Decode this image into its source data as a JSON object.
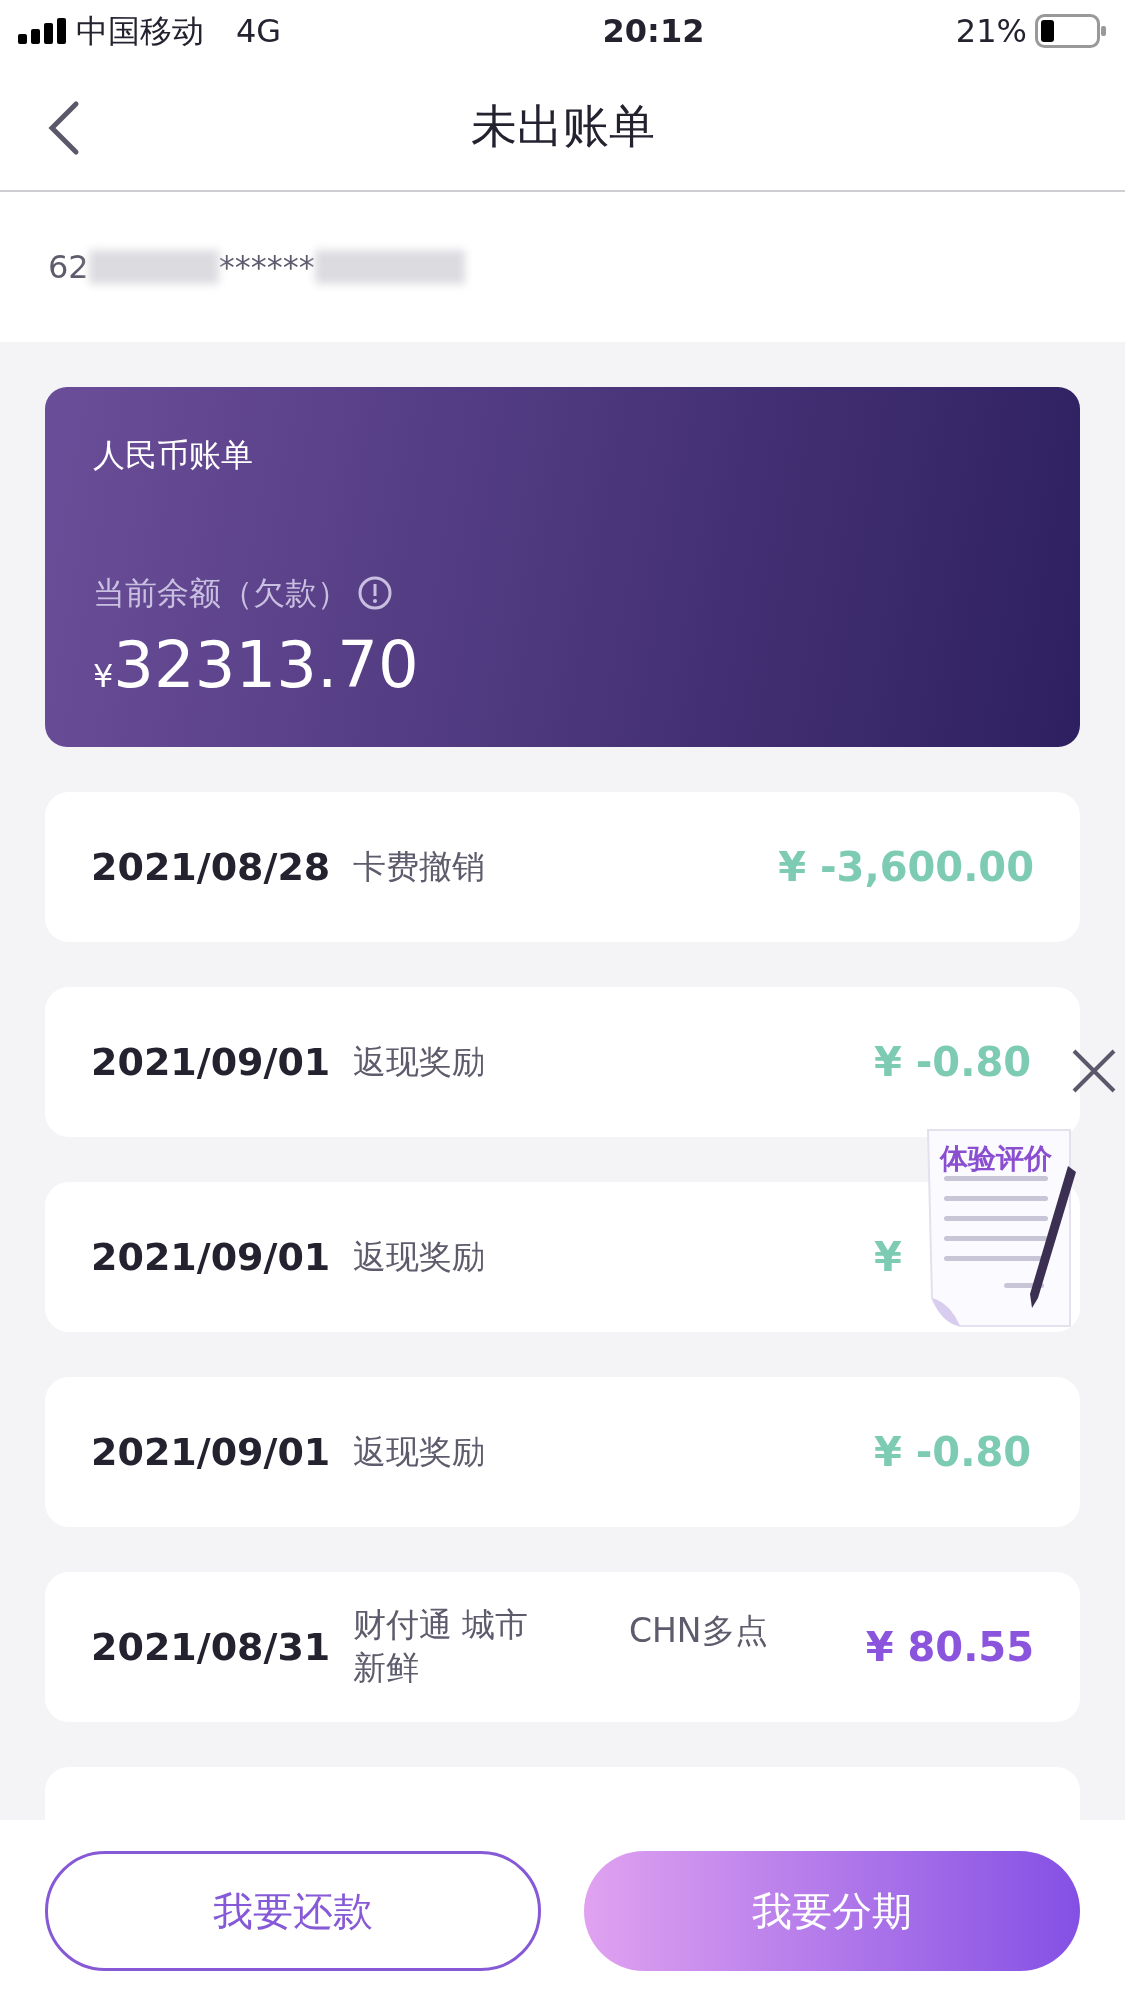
{
  "status_bar": {
    "carrier": "中国移动",
    "network": "4G",
    "time": "20:12",
    "battery": "21%"
  },
  "nav": {
    "title": "未出账单"
  },
  "card_number": {
    "prefix": "62",
    "masked": "******"
  },
  "balance_card": {
    "title": "人民币账单",
    "label": "当前余额（欠款）",
    "currency": "¥",
    "amount": "32313.70"
  },
  "transactions": [
    {
      "date": "2021/08/28",
      "description": "卡费撤销",
      "amount": "¥ -3,600.00",
      "kind": "credit"
    },
    {
      "date": "2021/09/01",
      "description": "返现奖励",
      "amount": "¥ -0.80",
      "kind": "credit"
    },
    {
      "date": "2021/09/01",
      "description": "返现奖励",
      "amount": "¥",
      "kind": "credit"
    },
    {
      "date": "2021/09/01",
      "description": "返现奖励",
      "amount": "¥ -0.80",
      "kind": "credit"
    },
    {
      "date": "2021/08/31",
      "description": "财付通 城市新鲜",
      "merchant": "CHN多点",
      "amount": "¥ 80.55",
      "kind": "debit"
    }
  ],
  "feedback_widget": {
    "label": "体验评价"
  },
  "buttons": [
    {
      "label": "我要还款",
      "kind": "outline"
    },
    {
      "label": "我要分期",
      "kind": "filled"
    }
  ]
}
